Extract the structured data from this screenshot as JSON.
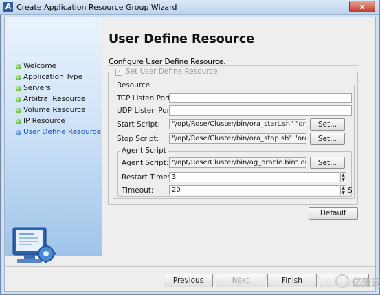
{
  "window": {
    "title": "Create Application Resource Group Wizard",
    "app_icon": "A",
    "close": "x"
  },
  "steps": [
    {
      "label": "Welcome",
      "state": "done"
    },
    {
      "label": "Application Type",
      "state": "done"
    },
    {
      "label": "Servers",
      "state": "done"
    },
    {
      "label": "Arbitral Resource",
      "state": "done"
    },
    {
      "label": "Volume Resource",
      "state": "done"
    },
    {
      "label": "IP Resource",
      "state": "done"
    },
    {
      "label": "User Define Resource",
      "state": "current"
    }
  ],
  "page": {
    "title": "User Define Resource",
    "subtitle": "Configure User Define Resource."
  },
  "set_user_define": {
    "label": "Set User Define Resource",
    "checked": true,
    "enabled": false,
    "check_mark": "✓"
  },
  "resource": {
    "legend": "Resource",
    "tcp_label": "TCP Listen Port:",
    "tcp_value": "",
    "udp_label": "UDP Listen Port:",
    "udp_value": "",
    "start_label": "Start Script:",
    "start_value": "\"/opt/Rose/Cluster/bin/ora_start.sh\" \"ora_l",
    "start_button": "Set...",
    "stop_label": "Stop Script:",
    "stop_value": "\"/opt/Rose/Cluster/bin/ora_stop.sh\" \"ora_l",
    "stop_button": "Set..."
  },
  "agent": {
    "legend": "Agent Script",
    "script_label": "Agent Script:",
    "script_value": "\"/opt/Rose/Cluster/bin/ag_oracle.bin\" ora_",
    "script_button": "Set...",
    "restart_label": "Restart Times:",
    "restart_value": "3",
    "timeout_label": "Timeout:",
    "timeout_value": "20",
    "timeout_unit": "S",
    "spin_up": "▲",
    "spin_down": "▼"
  },
  "buttons": {
    "default": "Default",
    "previous": "Previous",
    "next": "Next",
    "finish": "Finish",
    "cancel": ""
  },
  "watermark": {
    "text": "亿速云"
  }
}
